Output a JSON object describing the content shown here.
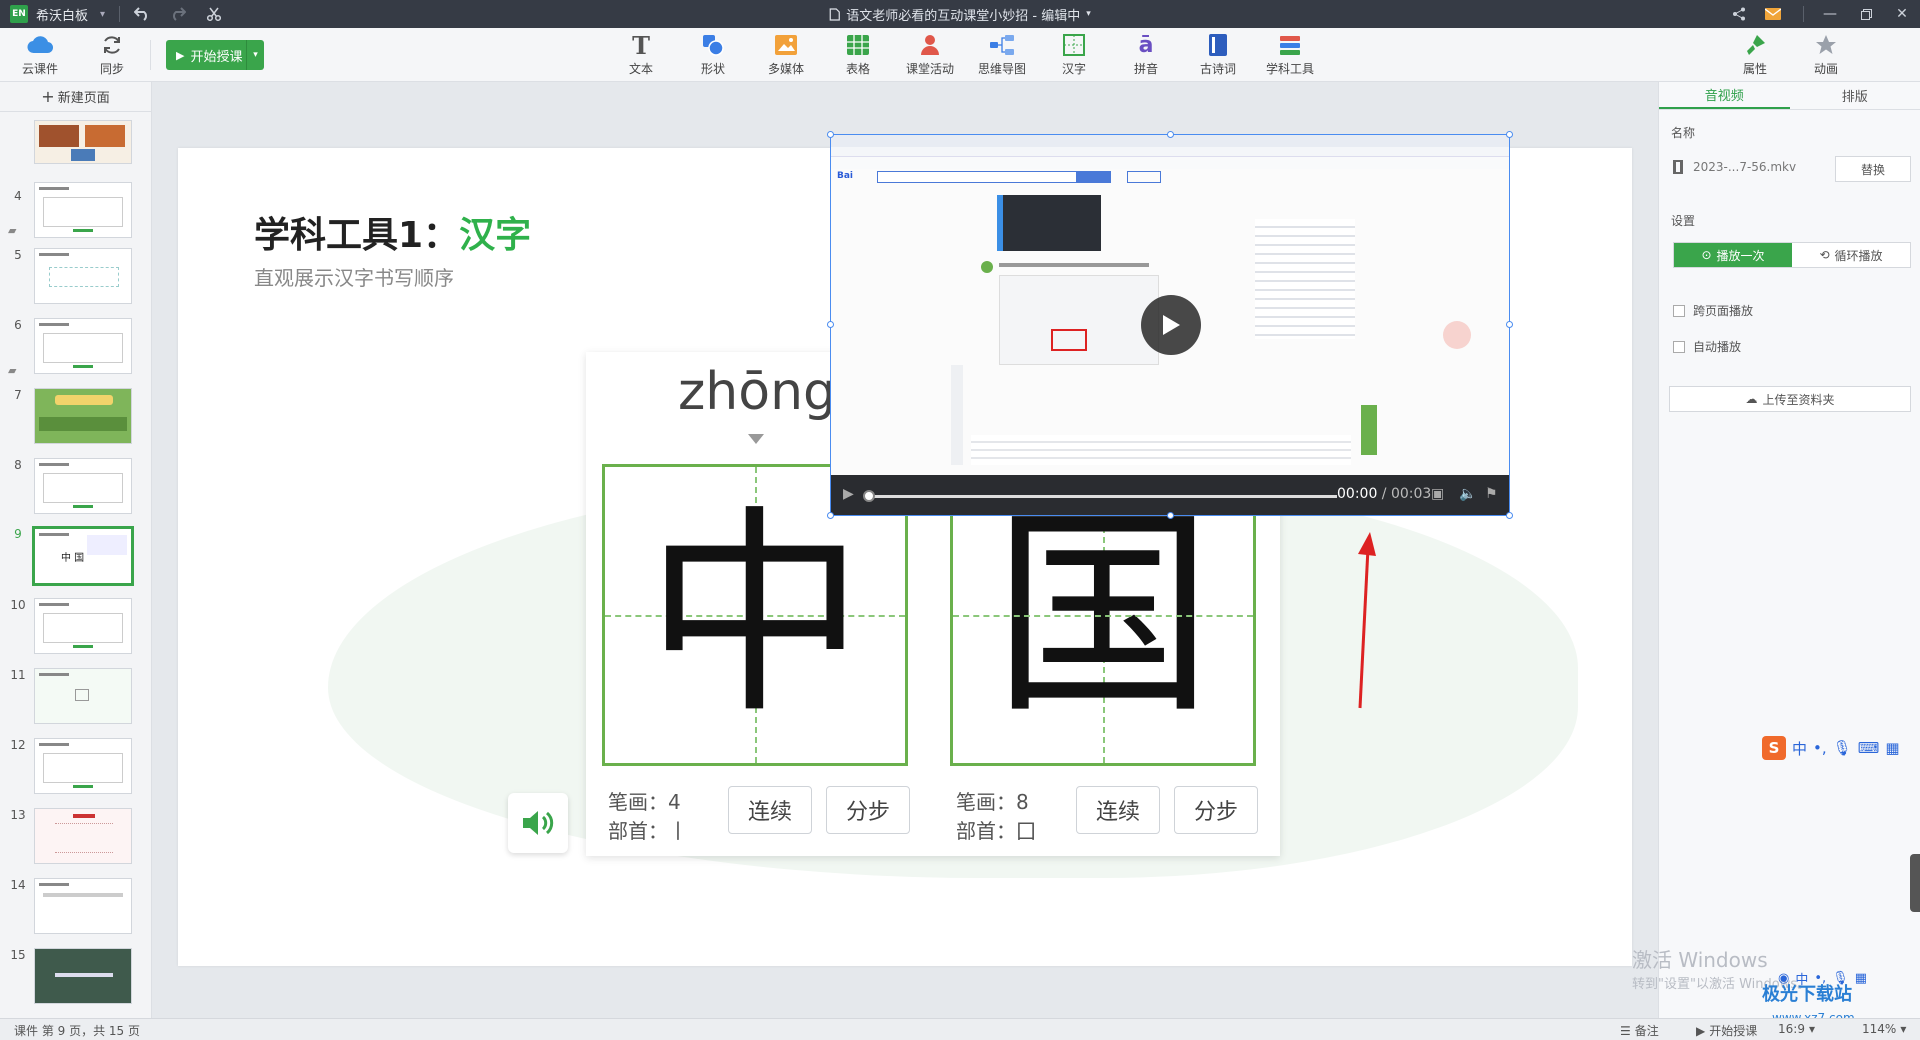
{
  "titlebar": {
    "logo": "EN",
    "app_name": "希沃白板",
    "doc_title": "语文老师必看的互动课堂小妙招 - 编辑中",
    "icons": [
      "undo-icon",
      "redo-icon",
      "scissors-icon",
      "share-icon",
      "mail-icon",
      "minimize-icon",
      "restore-icon",
      "close-icon"
    ]
  },
  "toolbar": {
    "cloud": "云课件",
    "sync": "同步",
    "start": "开始授课",
    "tools": [
      {
        "label": "文本",
        "icon": "text-icon"
      },
      {
        "label": "形状",
        "icon": "shape-icon"
      },
      {
        "label": "多媒体",
        "icon": "media-icon"
      },
      {
        "label": "表格",
        "icon": "table-icon"
      },
      {
        "label": "课堂活动",
        "icon": "activity-icon"
      },
      {
        "label": "思维导图",
        "icon": "mindmap-icon"
      },
      {
        "label": "汉字",
        "icon": "hanzi-icon"
      },
      {
        "label": "拼音",
        "icon": "pinyin-icon"
      },
      {
        "label": "古诗词",
        "icon": "poem-icon"
      },
      {
        "label": "学科工具",
        "icon": "subject-tools-icon"
      }
    ],
    "props": "属性",
    "anim": "动画"
  },
  "left": {
    "new_page": "新建页面",
    "slides": [
      "4",
      "5",
      "6",
      "7",
      "8",
      "9",
      "10",
      "11",
      "12",
      "13",
      "14",
      "15"
    ],
    "active_slide": "9"
  },
  "slide": {
    "title_prefix": "学科工具1：",
    "title_highlight": "汉字",
    "subtitle": "直观展示汉字书写顺序",
    "pinyin": "zhōng",
    "chars": [
      "中",
      "国"
    ],
    "stroke_label": "笔画：",
    "radical_label": "部首：",
    "char1": {
      "strokes": "4",
      "radical": "丨"
    },
    "char2": {
      "strokes": "8",
      "radical": "囗"
    },
    "btn_continuous": "连续",
    "btn_step": "分步"
  },
  "video": {
    "time_current": "00:00",
    "time_sep": " / ",
    "time_total": "00:03",
    "progress": 0
  },
  "right": {
    "tab_av": "音视频",
    "tab_layout": "排版",
    "name_label": "名称",
    "file_name": "2023-...7-56.mkv",
    "replace": "替换",
    "settings_label": "设置",
    "play_once": "播放一次",
    "loop": "循环播放",
    "cross_page": "跨页面播放",
    "autoplay": "自动播放",
    "upload": "上传至资料夹"
  },
  "status": {
    "page_info": "课件 第 9 页，共 15 页",
    "notes": "备注",
    "start": "开始授课",
    "ratio": "16:9",
    "zoom": "114%"
  },
  "watermark": {
    "line1": "激活 Windows",
    "line2": "转到\"设置\"以激活 Windows。"
  },
  "brand": {
    "name": "极光下载站",
    "url": "www.xz7.com"
  },
  "ime": {
    "lang": "中"
  },
  "colors": {
    "accent": "#3aa54b",
    "titlebar": "#363b45",
    "grid_green": "#6ab04c",
    "arrow_red": "#d22"
  }
}
